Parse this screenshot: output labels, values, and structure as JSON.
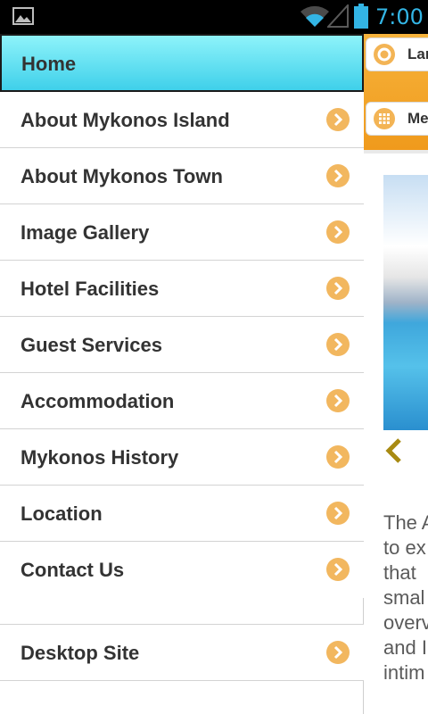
{
  "status_bar": {
    "time": "7:00",
    "accent_color": "#33b5e5",
    "icons": [
      "image-notification-icon",
      "wifi-icon",
      "signal-icon",
      "battery-icon"
    ]
  },
  "menu": {
    "home_label": "Home",
    "items": [
      {
        "label": "About Mykonos Island"
      },
      {
        "label": "About Mykonos Town"
      },
      {
        "label": "Image Gallery"
      },
      {
        "label": "Hotel Facilities"
      },
      {
        "label": "Guest Services"
      },
      {
        "label": "Accommodation"
      },
      {
        "label": "Mykonos History"
      },
      {
        "label": "Location"
      },
      {
        "label": "Contact Us"
      }
    ],
    "desktop_label": "Desktop Site",
    "home_color": "#5ddff0",
    "chevron_color": "#f2b75f"
  },
  "background_page": {
    "language_button": "Lan",
    "menu_button": "Me",
    "bar_color": "#f3a72b",
    "text_lines": [
      "The A",
      "to ex",
      "that",
      "smal",
      "overv",
      "and I",
      "intim"
    ]
  }
}
